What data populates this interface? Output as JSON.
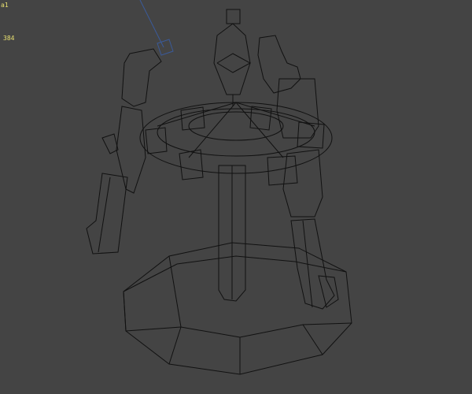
{
  "viewport": {
    "stat_top": "a1",
    "stat_count": "384",
    "background_color": "#444444",
    "wire_color": "#111111",
    "gizmo_color": "#3a5a9a"
  }
}
